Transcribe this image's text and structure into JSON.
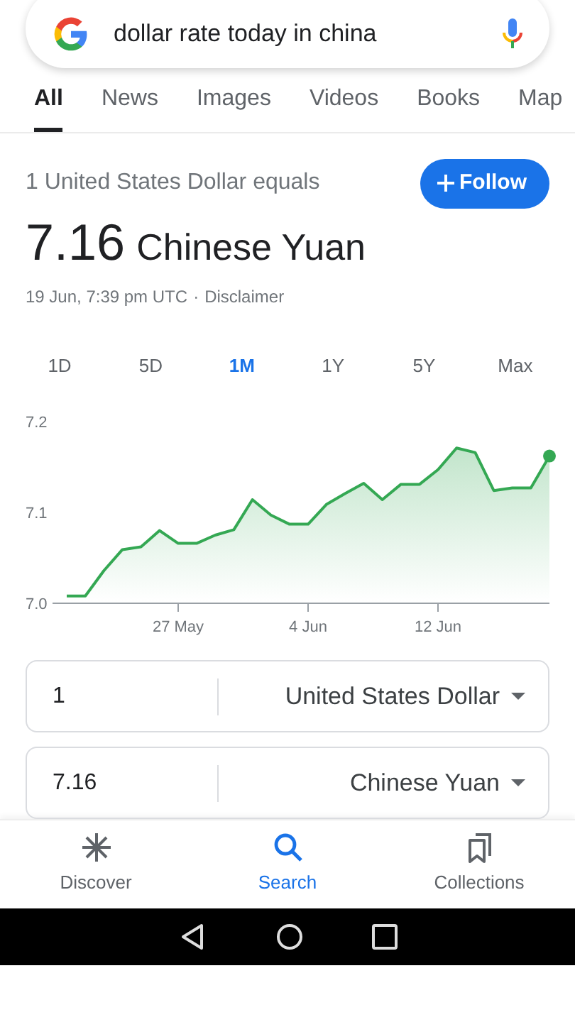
{
  "search": {
    "query": "dollar rate today in china"
  },
  "tabs": [
    {
      "label": "All",
      "selected": true
    },
    {
      "label": "News",
      "selected": false
    },
    {
      "label": "Images",
      "selected": false
    },
    {
      "label": "Videos",
      "selected": false
    },
    {
      "label": "Books",
      "selected": false
    },
    {
      "label": "Map",
      "selected": false
    }
  ],
  "result": {
    "subtitle": "1 United States Dollar equals",
    "follow_button": "Follow",
    "value": "7.16",
    "currency": "Chinese Yuan",
    "timestamp": "19 Jun, 7:39 pm UTC",
    "separator": "·",
    "disclaimer": "Disclaimer"
  },
  "ranges": [
    {
      "label": "1D",
      "selected": false
    },
    {
      "label": "5D",
      "selected": false
    },
    {
      "label": "1M",
      "selected": true
    },
    {
      "label": "1Y",
      "selected": false
    },
    {
      "label": "5Y",
      "selected": false
    },
    {
      "label": "Max",
      "selected": false
    }
  ],
  "chart_data": {
    "type": "area",
    "categories": [
      null,
      null,
      null,
      null,
      null,
      null,
      "27 May",
      null,
      null,
      null,
      null,
      null,
      null,
      "4 Jun",
      null,
      null,
      null,
      null,
      null,
      null,
      "12 Jun",
      null,
      null,
      null,
      null,
      null,
      null
    ],
    "series": [
      {
        "color": "#34a853",
        "values": [
          7.008,
          7.008,
          7.036,
          7.059,
          7.062,
          7.08,
          7.066,
          7.066,
          7.075,
          7.081,
          7.114,
          7.097,
          7.087,
          7.087,
          7.109,
          7.121,
          7.132,
          7.114,
          7.131,
          7.131,
          7.147,
          7.171,
          7.166,
          7.124,
          7.127,
          7.127,
          7.162
        ]
      }
    ],
    "ylim": [
      7.0,
      7.2
    ],
    "yticks": [
      {
        "value": 7.0,
        "label": "7.0"
      },
      {
        "value": 7.1,
        "label": "7.1"
      },
      {
        "value": 7.2,
        "label": "7.2"
      }
    ]
  },
  "converter": [
    {
      "amount": "1",
      "currency": "United States Dollar"
    },
    {
      "amount": "7.16",
      "currency": "Chinese Yuan"
    }
  ],
  "bottom_nav": [
    {
      "kind": "discover",
      "label": "Discover",
      "selected": false
    },
    {
      "kind": "search",
      "label": "Search",
      "selected": true
    },
    {
      "kind": "collections",
      "label": "Collections",
      "selected": false
    }
  ],
  "system_nav": [
    {
      "kind": "back"
    },
    {
      "kind": "home"
    },
    {
      "kind": "recents"
    }
  ]
}
